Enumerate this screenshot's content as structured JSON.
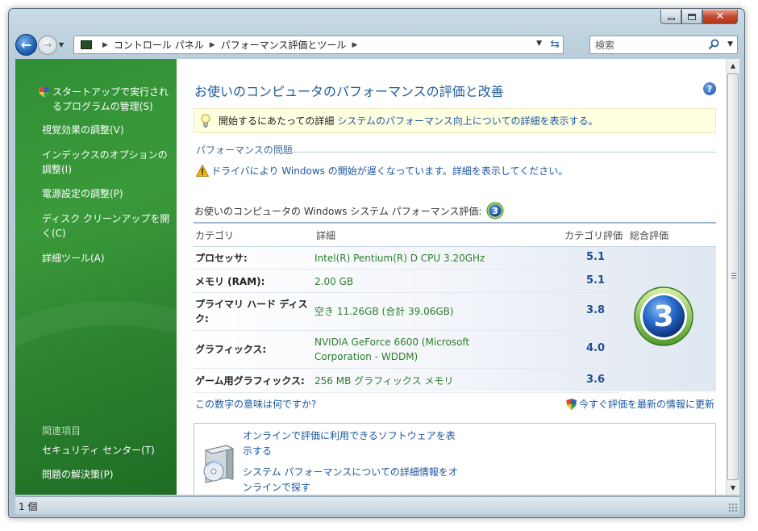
{
  "window": {
    "address_crumbs": [
      "コントロール パネル",
      "パフォーマンス評価とツール"
    ],
    "search_placeholder": "検索",
    "status_text": "1 個"
  },
  "sidebar": {
    "tasks": [
      {
        "label": "スタートアップで実行されるプログラムの管理(S)",
        "shield": true
      },
      {
        "label": "視覚効果の調整(V)"
      },
      {
        "label": "インデックスのオプションの調整(I)"
      },
      {
        "label": "電源設定の調整(P)"
      },
      {
        "label": "ディスク クリーンアップを開く(C)"
      },
      {
        "label": "詳細ツール(A)"
      }
    ],
    "related_heading": "関連項目",
    "related": [
      {
        "label": "セキュリティ センター(T)"
      },
      {
        "label": "問題の解決策(P)"
      }
    ]
  },
  "main": {
    "title": "お使いのコンピュータのパフォーマンスの評価と改善",
    "info_bar": {
      "lead": "開始するにあたっての詳細",
      "link": "システムのパフォーマンス向上についての詳細を表示する。"
    },
    "issues_heading": "パフォーマンスの問題",
    "issue_text": "ドライバにより Windows の開始が遅くなっています。詳細を表示してください。",
    "score_label": "お使いのコンピュータの Windows システム パフォーマンス評価:",
    "base_score": "3",
    "table": {
      "headers": {
        "category": "カテゴリ",
        "details": "詳細",
        "subscore": "カテゴリ評価",
        "base": "総合評価"
      },
      "rows": [
        {
          "category": "プロセッサ:",
          "details": "Intel(R) Pentium(R) D CPU 3.20GHz",
          "score": "5.1"
        },
        {
          "category": "メモリ (RAM):",
          "details": "2.00 GB",
          "score": "5.1"
        },
        {
          "category": "プライマリ ハード ディスク:",
          "details": "空き 11.26GB (合計 39.06GB)",
          "score": "3.8"
        },
        {
          "category": "グラフィックス:",
          "details": "NVIDIA GeForce 6600 (Microsoft Corporation - WDDM)",
          "score": "4.0"
        },
        {
          "category": "ゲーム用グラフィックス:",
          "details": "256 MB グラフィックス メモリ",
          "score": "3.6"
        }
      ]
    },
    "link_meaning": "この数字の意味は何ですか?",
    "link_update": "今すぐ評価を最新の情報に更新",
    "online_links": [
      "オンラインで評価に利用できるソフトウェアを表示する",
      "システム パフォーマンスについての詳細情報をオンラインで探す"
    ]
  },
  "colors": {
    "sidebar_green": "#2f8f35",
    "link_blue": "#1b57a0",
    "detail_green": "#2d7d2d",
    "title_blue": "#1f5c9a"
  }
}
